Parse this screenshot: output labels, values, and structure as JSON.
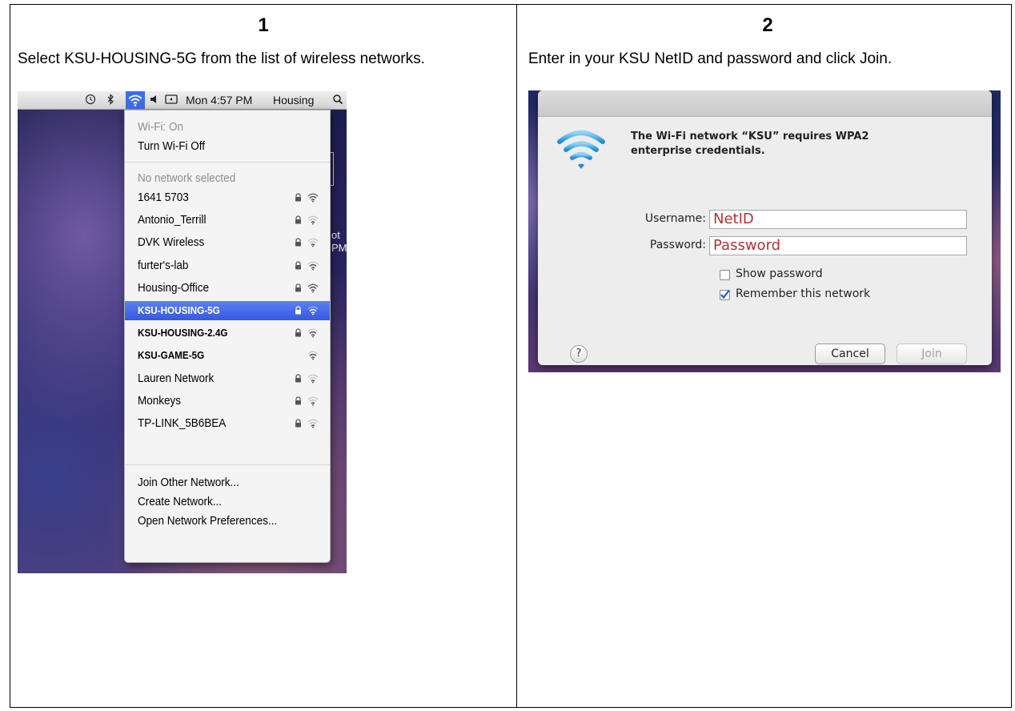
{
  "steps": [
    {
      "number": "1",
      "instruction": "Select KSU-HOUSING-5G from the list of wireless networks."
    },
    {
      "number": "2",
      "instruction": "Enter in your KSU NetID and password and click Join."
    }
  ],
  "menubar": {
    "clock": "Mon 4:57 PM",
    "user": "Housing",
    "icons": [
      "time-machine-icon",
      "bluetooth-icon",
      "wifi-icon",
      "volume-icon",
      "display-icon",
      "spotlight-search-icon"
    ]
  },
  "wifi_menu": {
    "status": "Wi-Fi: On",
    "toggle": "Turn Wi-Fi Off",
    "no_network": "No network selected",
    "networks": [
      {
        "name": "1641 5703",
        "locked": true,
        "strength": 4
      },
      {
        "name": "Antonio_Terrill",
        "locked": true,
        "strength": 2
      },
      {
        "name": "DVK Wireless",
        "locked": true,
        "strength": 2
      },
      {
        "name": "furter's-lab",
        "locked": true,
        "strength": 3
      },
      {
        "name": "Housing-Office",
        "locked": true,
        "strength": 4
      },
      {
        "name": "KSU-HOUSING-5G",
        "locked": true,
        "strength": 3,
        "selected": true
      },
      {
        "name": "KSU-HOUSING-2.4G",
        "locked": true,
        "strength": 3
      },
      {
        "name": "KSU-GAME-5G",
        "locked": false,
        "strength": 3
      },
      {
        "name": "Lauren Network",
        "locked": true,
        "strength": 2
      },
      {
        "name": "Monkeys",
        "locked": true,
        "strength": 2
      },
      {
        "name": "TP-LINK_5B6BEA",
        "locked": true,
        "strength": 2
      }
    ],
    "footer_items": [
      "Join Other Network...",
      "Create Network...",
      "Open Network Preferences..."
    ],
    "behind_text": [
      "ot",
      "PM"
    ]
  },
  "dialog": {
    "message": "The Wi-Fi network “KSU” requires WPA2 enterprise credentials.",
    "username_label": "Username:",
    "username_value": "NetID",
    "password_label": "Password:",
    "password_value": "Password",
    "show_password_label": "Show password",
    "show_password_checked": false,
    "remember_label": "Remember this network",
    "remember_checked": true,
    "help_label": "?",
    "cancel_label": "Cancel",
    "join_label": "Join"
  },
  "colors": {
    "selection": "#3a5de3",
    "field_text": "#b23333"
  }
}
